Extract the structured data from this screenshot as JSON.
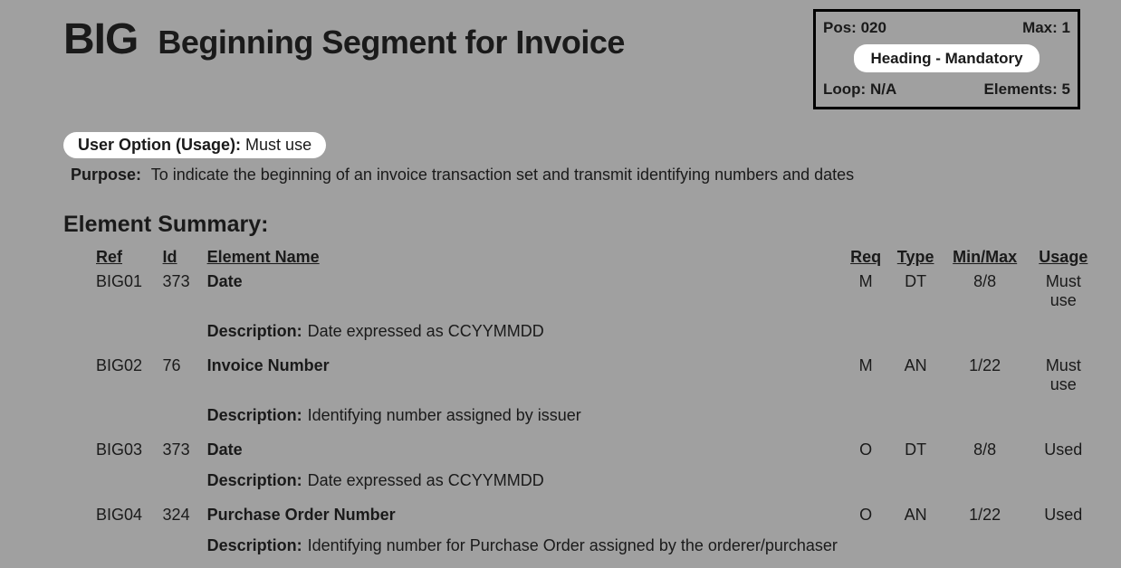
{
  "segment": {
    "code": "BIG",
    "title": "Beginning Segment for Invoice"
  },
  "info_box": {
    "pos_label": "Pos:",
    "pos_value": "020",
    "max_label": "Max:",
    "max_value": "1",
    "heading_pill": "Heading - Mandatory",
    "loop_label": "Loop:",
    "loop_value": "N/A",
    "elements_label": "Elements:",
    "elements_value": "5"
  },
  "usage": {
    "label": "User Option (Usage):",
    "value": "Must use"
  },
  "purpose": {
    "label": "Purpose:",
    "text": "To indicate the beginning of an invoice transaction set and transmit identifying numbers and dates"
  },
  "summary_heading": "Element Summary:",
  "headers": {
    "ref": "Ref",
    "id": "Id",
    "name": "Element Name",
    "req": "Req",
    "type": "Type",
    "minmax": "Min/Max",
    "usage": "Usage"
  },
  "description_label": "Description:",
  "elements": [
    {
      "ref": "BIG01",
      "id": "373",
      "name": "Date",
      "req": "M",
      "type": "DT",
      "minmax": "8/8",
      "usage": "Must use",
      "description": "Date expressed as CCYYMMDD"
    },
    {
      "ref": "BIG02",
      "id": "76",
      "name": "Invoice Number",
      "req": "M",
      "type": "AN",
      "minmax": "1/22",
      "usage": "Must use",
      "description": "Identifying number assigned by issuer"
    },
    {
      "ref": "BIG03",
      "id": "373",
      "name": "Date",
      "req": "O",
      "type": "DT",
      "minmax": "8/8",
      "usage": "Used",
      "description": "Date expressed as CCYYMMDD"
    },
    {
      "ref": "BIG04",
      "id": "324",
      "name": "Purchase Order Number",
      "req": "O",
      "type": "AN",
      "minmax": "1/22",
      "usage": "Used",
      "description": "Identifying number for Purchase Order assigned by the orderer/purchaser"
    }
  ]
}
